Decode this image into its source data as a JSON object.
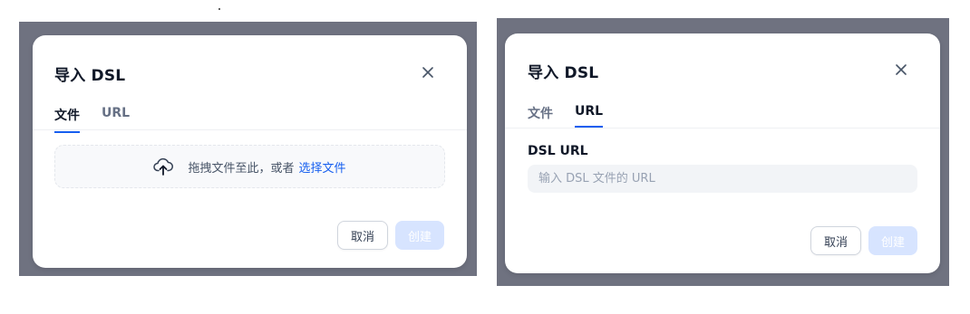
{
  "left_dialog": {
    "title": "导入 DSL",
    "tabs": [
      {
        "label": "文件",
        "active": true
      },
      {
        "label": "URL",
        "active": false
      }
    ],
    "dropzone": {
      "text": "拖拽文件至此，或者",
      "link": "选择文件",
      "icon": "cloud-upload-icon"
    },
    "buttons": {
      "cancel": "取消",
      "create": "创建"
    }
  },
  "right_dialog": {
    "title": "导入 DSL",
    "tabs": [
      {
        "label": "文件",
        "active": false
      },
      {
        "label": "URL",
        "active": true
      }
    ],
    "field_label": "DSL URL",
    "input": {
      "value": "",
      "placeholder": "输入 DSL 文件的 URL"
    },
    "buttons": {
      "cancel": "取消",
      "create": "创建"
    }
  },
  "colors": {
    "overlay": "#6f7280",
    "accent": "#155eef",
    "create_disabled": "#d1e0ff"
  }
}
